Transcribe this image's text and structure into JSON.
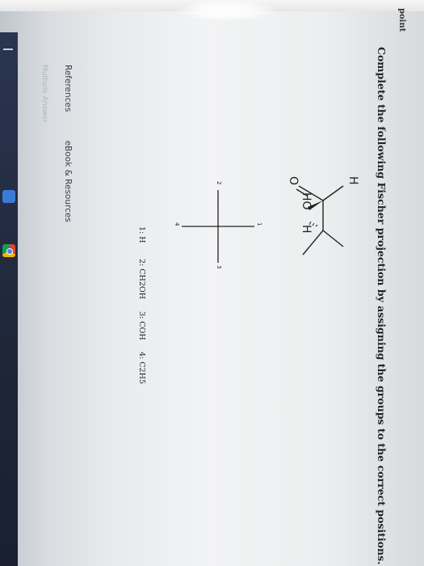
{
  "question": {
    "partial_header": "point",
    "prompt": "Complete the following Fischer projection by assigning the groups to the correct positions."
  },
  "fischer": {
    "positions": [
      "1",
      "2",
      "3",
      "4"
    ]
  },
  "molecule": {
    "atoms": [
      "O",
      "H",
      "HO",
      "H"
    ]
  },
  "groups": [
    {
      "num": "1:",
      "label": "H"
    },
    {
      "num": "2:",
      "label": "CH2OH"
    },
    {
      "num": "3:",
      "label": "COH"
    },
    {
      "num": "4:",
      "label": "C2H5"
    }
  ],
  "footer": {
    "references": "References",
    "ebook": "eBook & Resources",
    "faded": "Multiple Answer"
  }
}
